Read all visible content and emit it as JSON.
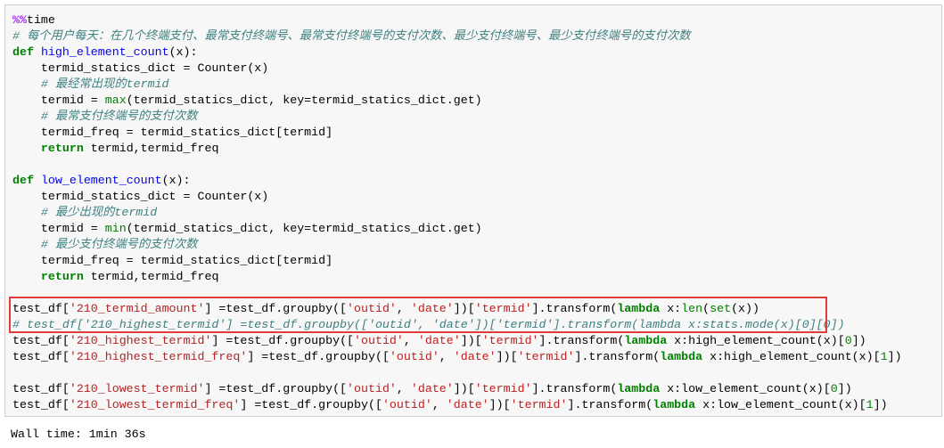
{
  "cell": {
    "lines": [
      [
        [
          "mg",
          "%%"
        ],
        [
          "t",
          "time"
        ]
      ],
      [
        [
          "cm",
          "# 每个用户每天：在几个终端支付、最常支付终端号、最常支付终端号的支付次数、最少支付终端号、最少支付终端号的支付次数"
        ]
      ],
      [
        [
          "kw",
          "def"
        ],
        [
          "t",
          " "
        ],
        [
          "fn",
          "high_element_count"
        ],
        [
          "t",
          "(x):"
        ]
      ],
      [
        [
          "t",
          "    termid_statics_dict = Counter(x)"
        ]
      ],
      [
        [
          "t",
          "    "
        ],
        [
          "cm",
          "# 最经常出现的termid"
        ]
      ],
      [
        [
          "t",
          "    termid = "
        ],
        [
          "bi",
          "max"
        ],
        [
          "t",
          "(termid_statics_dict, key=termid_statics_dict.get)"
        ]
      ],
      [
        [
          "t",
          "    "
        ],
        [
          "cm",
          "# 最常支付终端号的支付次数"
        ]
      ],
      [
        [
          "t",
          "    termid_freq = termid_statics_dict[termid]"
        ]
      ],
      [
        [
          "t",
          "    "
        ],
        [
          "kw",
          "return"
        ],
        [
          "t",
          " termid,termid_freq"
        ]
      ],
      [
        [
          "t",
          ""
        ]
      ],
      [
        [
          "kw",
          "def"
        ],
        [
          "t",
          " "
        ],
        [
          "fn",
          "low_element_count"
        ],
        [
          "t",
          "(x):"
        ]
      ],
      [
        [
          "t",
          "    termid_statics_dict = Counter(x)"
        ]
      ],
      [
        [
          "t",
          "    "
        ],
        [
          "cm",
          "# 最少出现的termid"
        ]
      ],
      [
        [
          "t",
          "    termid = "
        ],
        [
          "bi",
          "min"
        ],
        [
          "t",
          "(termid_statics_dict, key=termid_statics_dict.get)"
        ]
      ],
      [
        [
          "t",
          "    "
        ],
        [
          "cm",
          "# 最少支付终端号的支付次数"
        ]
      ],
      [
        [
          "t",
          "    termid_freq = termid_statics_dict[termid]"
        ]
      ],
      [
        [
          "t",
          "    "
        ],
        [
          "kw",
          "return"
        ],
        [
          "t",
          " termid,termid_freq"
        ]
      ],
      [
        [
          "t",
          ""
        ]
      ],
      [
        [
          "t",
          "test_df["
        ],
        [
          "str",
          "'210_termid_amount'"
        ],
        [
          "t",
          "] =test_df.groupby(["
        ],
        [
          "str",
          "'outid'"
        ],
        [
          "t",
          ", "
        ],
        [
          "str",
          "'date'"
        ],
        [
          "t",
          "])["
        ],
        [
          "str",
          "'termid'"
        ],
        [
          "t",
          "].transform("
        ],
        [
          "kw",
          "lambda"
        ],
        [
          "t",
          " x:"
        ],
        [
          "bi",
          "len"
        ],
        [
          "t",
          "("
        ],
        [
          "bi",
          "set"
        ],
        [
          "t",
          "(x))"
        ]
      ],
      [
        [
          "cm",
          "# test_df['210_highest_termid'] =test_df.groupby(['outid', 'date'])['termid'].transform(lambda x:stats.mode(x)[0][0])"
        ]
      ],
      [
        [
          "t",
          "test_df["
        ],
        [
          "str",
          "'210_highest_termid'"
        ],
        [
          "t",
          "] =test_df.groupby(["
        ],
        [
          "str",
          "'outid'"
        ],
        [
          "t",
          ", "
        ],
        [
          "str",
          "'date'"
        ],
        [
          "t",
          "])["
        ],
        [
          "str",
          "'termid'"
        ],
        [
          "t",
          "].transform("
        ],
        [
          "kw",
          "lambda"
        ],
        [
          "t",
          " x:high_element_count(x)["
        ],
        [
          "num",
          "0"
        ],
        [
          "t",
          "])"
        ]
      ],
      [
        [
          "t",
          "test_df["
        ],
        [
          "str",
          "'210_highest_termid_freq'"
        ],
        [
          "t",
          "] =test_df.groupby(["
        ],
        [
          "str",
          "'outid'"
        ],
        [
          "t",
          ", "
        ],
        [
          "str",
          "'date'"
        ],
        [
          "t",
          "])["
        ],
        [
          "str",
          "'termid'"
        ],
        [
          "t",
          "].transform("
        ],
        [
          "kw",
          "lambda"
        ],
        [
          "t",
          " x:high_element_count(x)["
        ],
        [
          "num",
          "1"
        ],
        [
          "t",
          "])"
        ]
      ],
      [
        [
          "t",
          ""
        ]
      ],
      [
        [
          "t",
          "test_df["
        ],
        [
          "str",
          "'210_lowest_termid'"
        ],
        [
          "t",
          "] =test_df.groupby(["
        ],
        [
          "str",
          "'outid'"
        ],
        [
          "t",
          ", "
        ],
        [
          "str",
          "'date'"
        ],
        [
          "t",
          "])["
        ],
        [
          "str",
          "'termid'"
        ],
        [
          "t",
          "].transform("
        ],
        [
          "kw",
          "lambda"
        ],
        [
          "t",
          " x:low_element_count(x)["
        ],
        [
          "num",
          "0"
        ],
        [
          "t",
          "])"
        ]
      ],
      [
        [
          "t",
          "test_df["
        ],
        [
          "str",
          "'210_lowest_termid_freq'"
        ],
        [
          "t",
          "] =test_df.groupby(["
        ],
        [
          "str",
          "'outid'"
        ],
        [
          "t",
          ", "
        ],
        [
          "str",
          "'date'"
        ],
        [
          "t",
          "])["
        ],
        [
          "str",
          "'termid'"
        ],
        [
          "t",
          "].transform("
        ],
        [
          "kw",
          "lambda"
        ],
        [
          "t",
          " x:low_element_count(x)["
        ],
        [
          "num",
          "1"
        ],
        [
          "t",
          "])"
        ]
      ]
    ]
  },
  "output": {
    "text": "Wall time: 1min 36s"
  },
  "colors": {
    "highlight_border": "#e03c3c",
    "cell_bg": "#f7f7f7"
  }
}
